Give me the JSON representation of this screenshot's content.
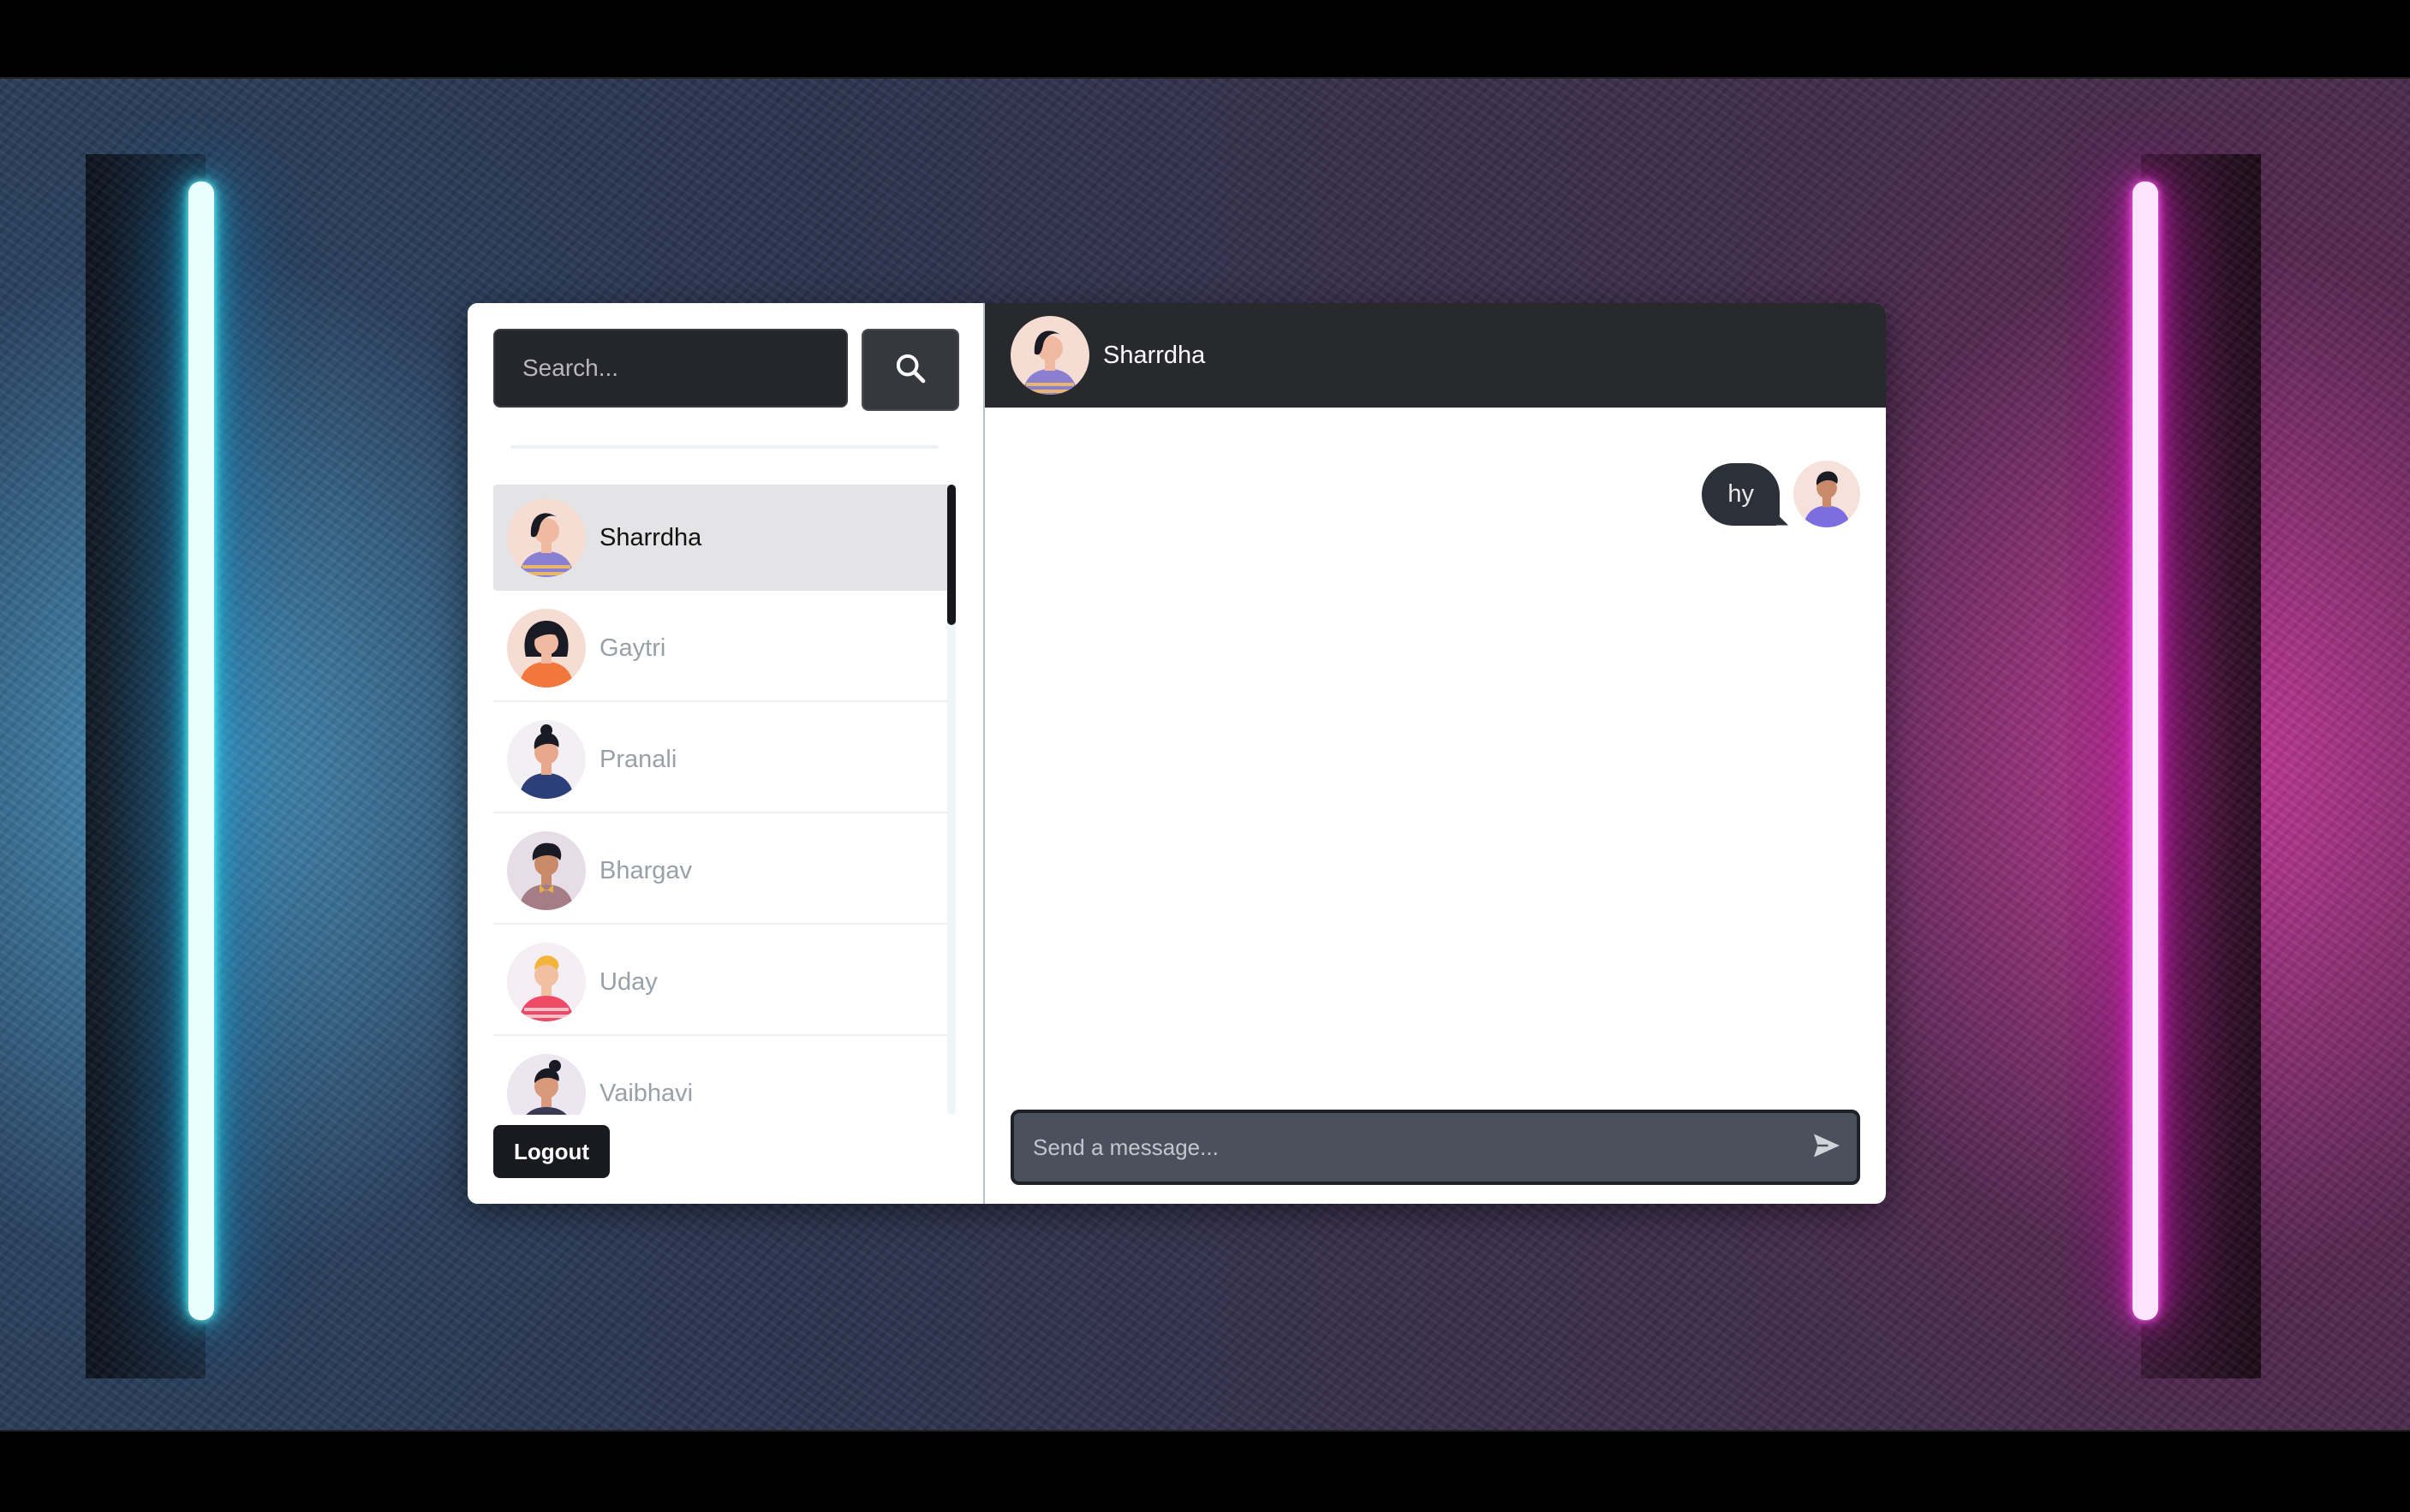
{
  "search": {
    "placeholder": "Search..."
  },
  "contacts": [
    {
      "name": "Sharrdha",
      "active": true
    },
    {
      "name": "Gaytri",
      "active": false
    },
    {
      "name": "Pranali",
      "active": false
    },
    {
      "name": "Bhargav",
      "active": false
    },
    {
      "name": "Uday",
      "active": false
    },
    {
      "name": "Vaibhavi",
      "active": false
    }
  ],
  "sidebar": {
    "logout_label": "Logout"
  },
  "chat": {
    "title": "Sharrdha",
    "messages": [
      {
        "text": "hy",
        "from": "me"
      }
    ],
    "composer_placeholder": "Send a message..."
  },
  "colors": {
    "header_bg": "#28292d",
    "active_contact_bg": "#e4e4e6",
    "bubble_bg": "#2c3038",
    "neon_left": "#2ee0f0",
    "neon_right": "#f040d8"
  }
}
